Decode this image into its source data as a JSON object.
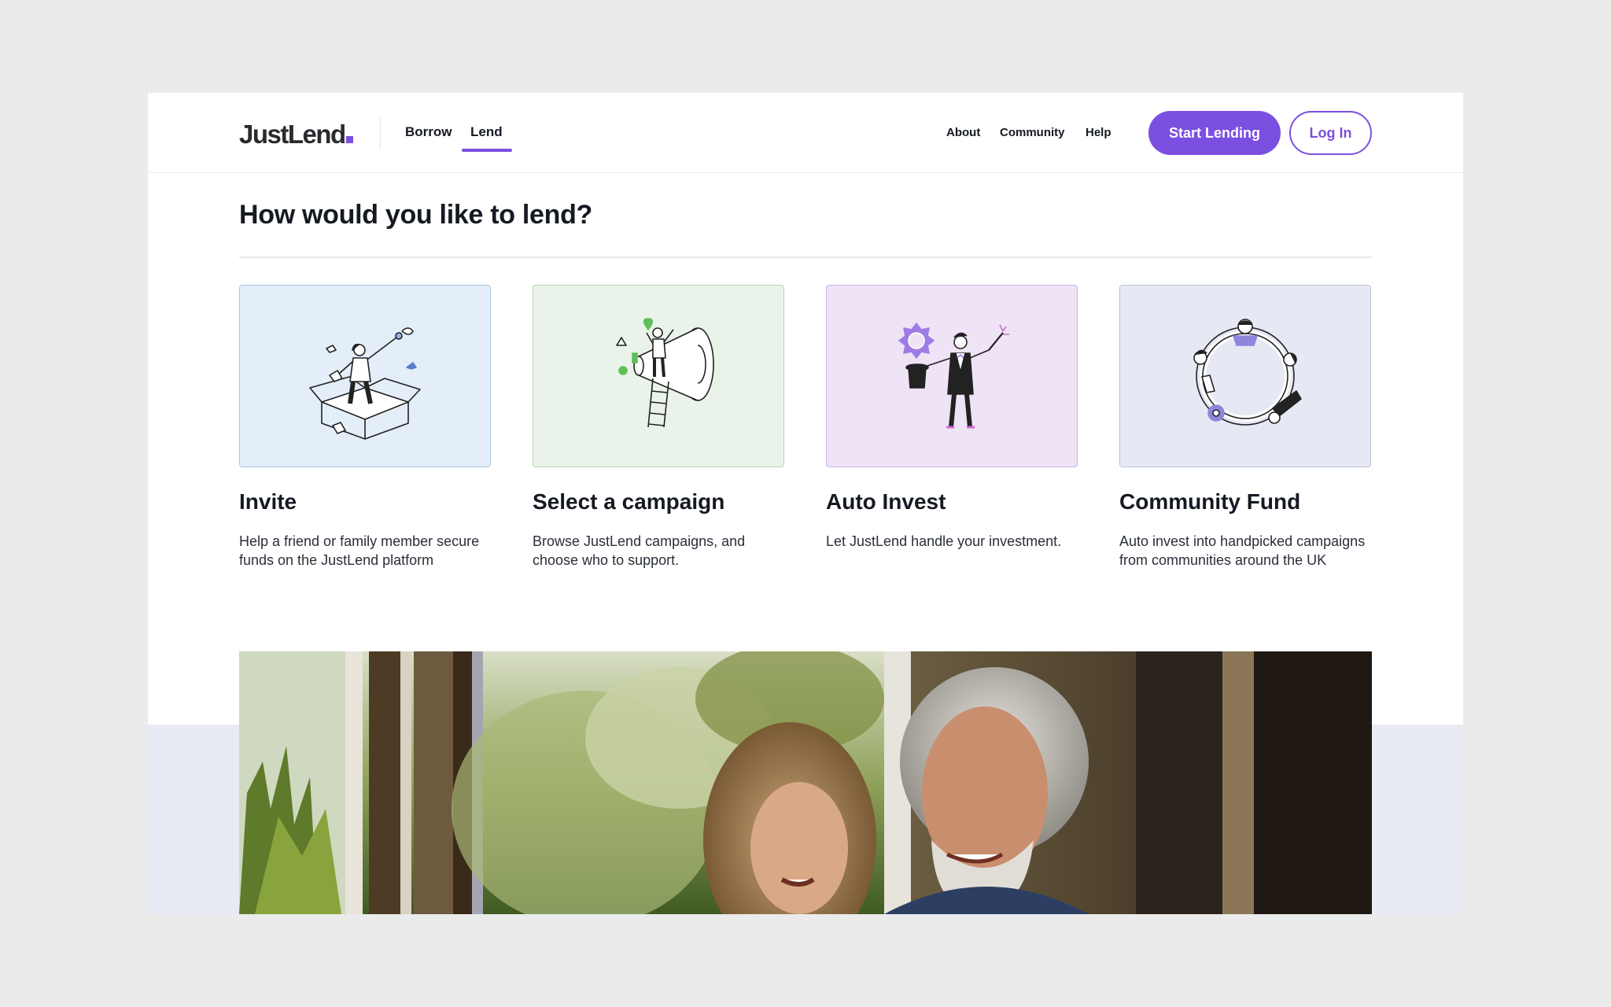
{
  "brand": {
    "name": "JustLend",
    "accent": "#7b4fe0"
  },
  "nav": {
    "tabs": [
      {
        "label": "Borrow",
        "active": false
      },
      {
        "label": "Lend",
        "active": true
      }
    ],
    "links": [
      "About",
      "Community",
      "Help"
    ],
    "start_button": "Start Lending",
    "login_button": "Log In"
  },
  "main": {
    "title": "How would you like to lend?",
    "cards": [
      {
        "title": "Invite",
        "description": "Help a friend or family member secure funds on the JustLend platform",
        "illustration": "person-in-box-illustration",
        "bg": "#e3eef9"
      },
      {
        "title": "Select a campaign",
        "description": "Browse JustLend campaigns, and choose who to support.",
        "illustration": "megaphone-ladder-illustration",
        "bg": "#eaf3e9"
      },
      {
        "title": "Auto Invest",
        "description": "Let JustLend handle your investment.",
        "illustration": "magician-illustration",
        "bg": "#efe3f6"
      },
      {
        "title": "Community Fund",
        "description": "Auto invest into handpicked campaigns from communities around the UK",
        "illustration": "people-circle-illustration",
        "bg": "#e6e8f4"
      }
    ]
  },
  "hero": {
    "image": "smiling-couple-photo"
  }
}
